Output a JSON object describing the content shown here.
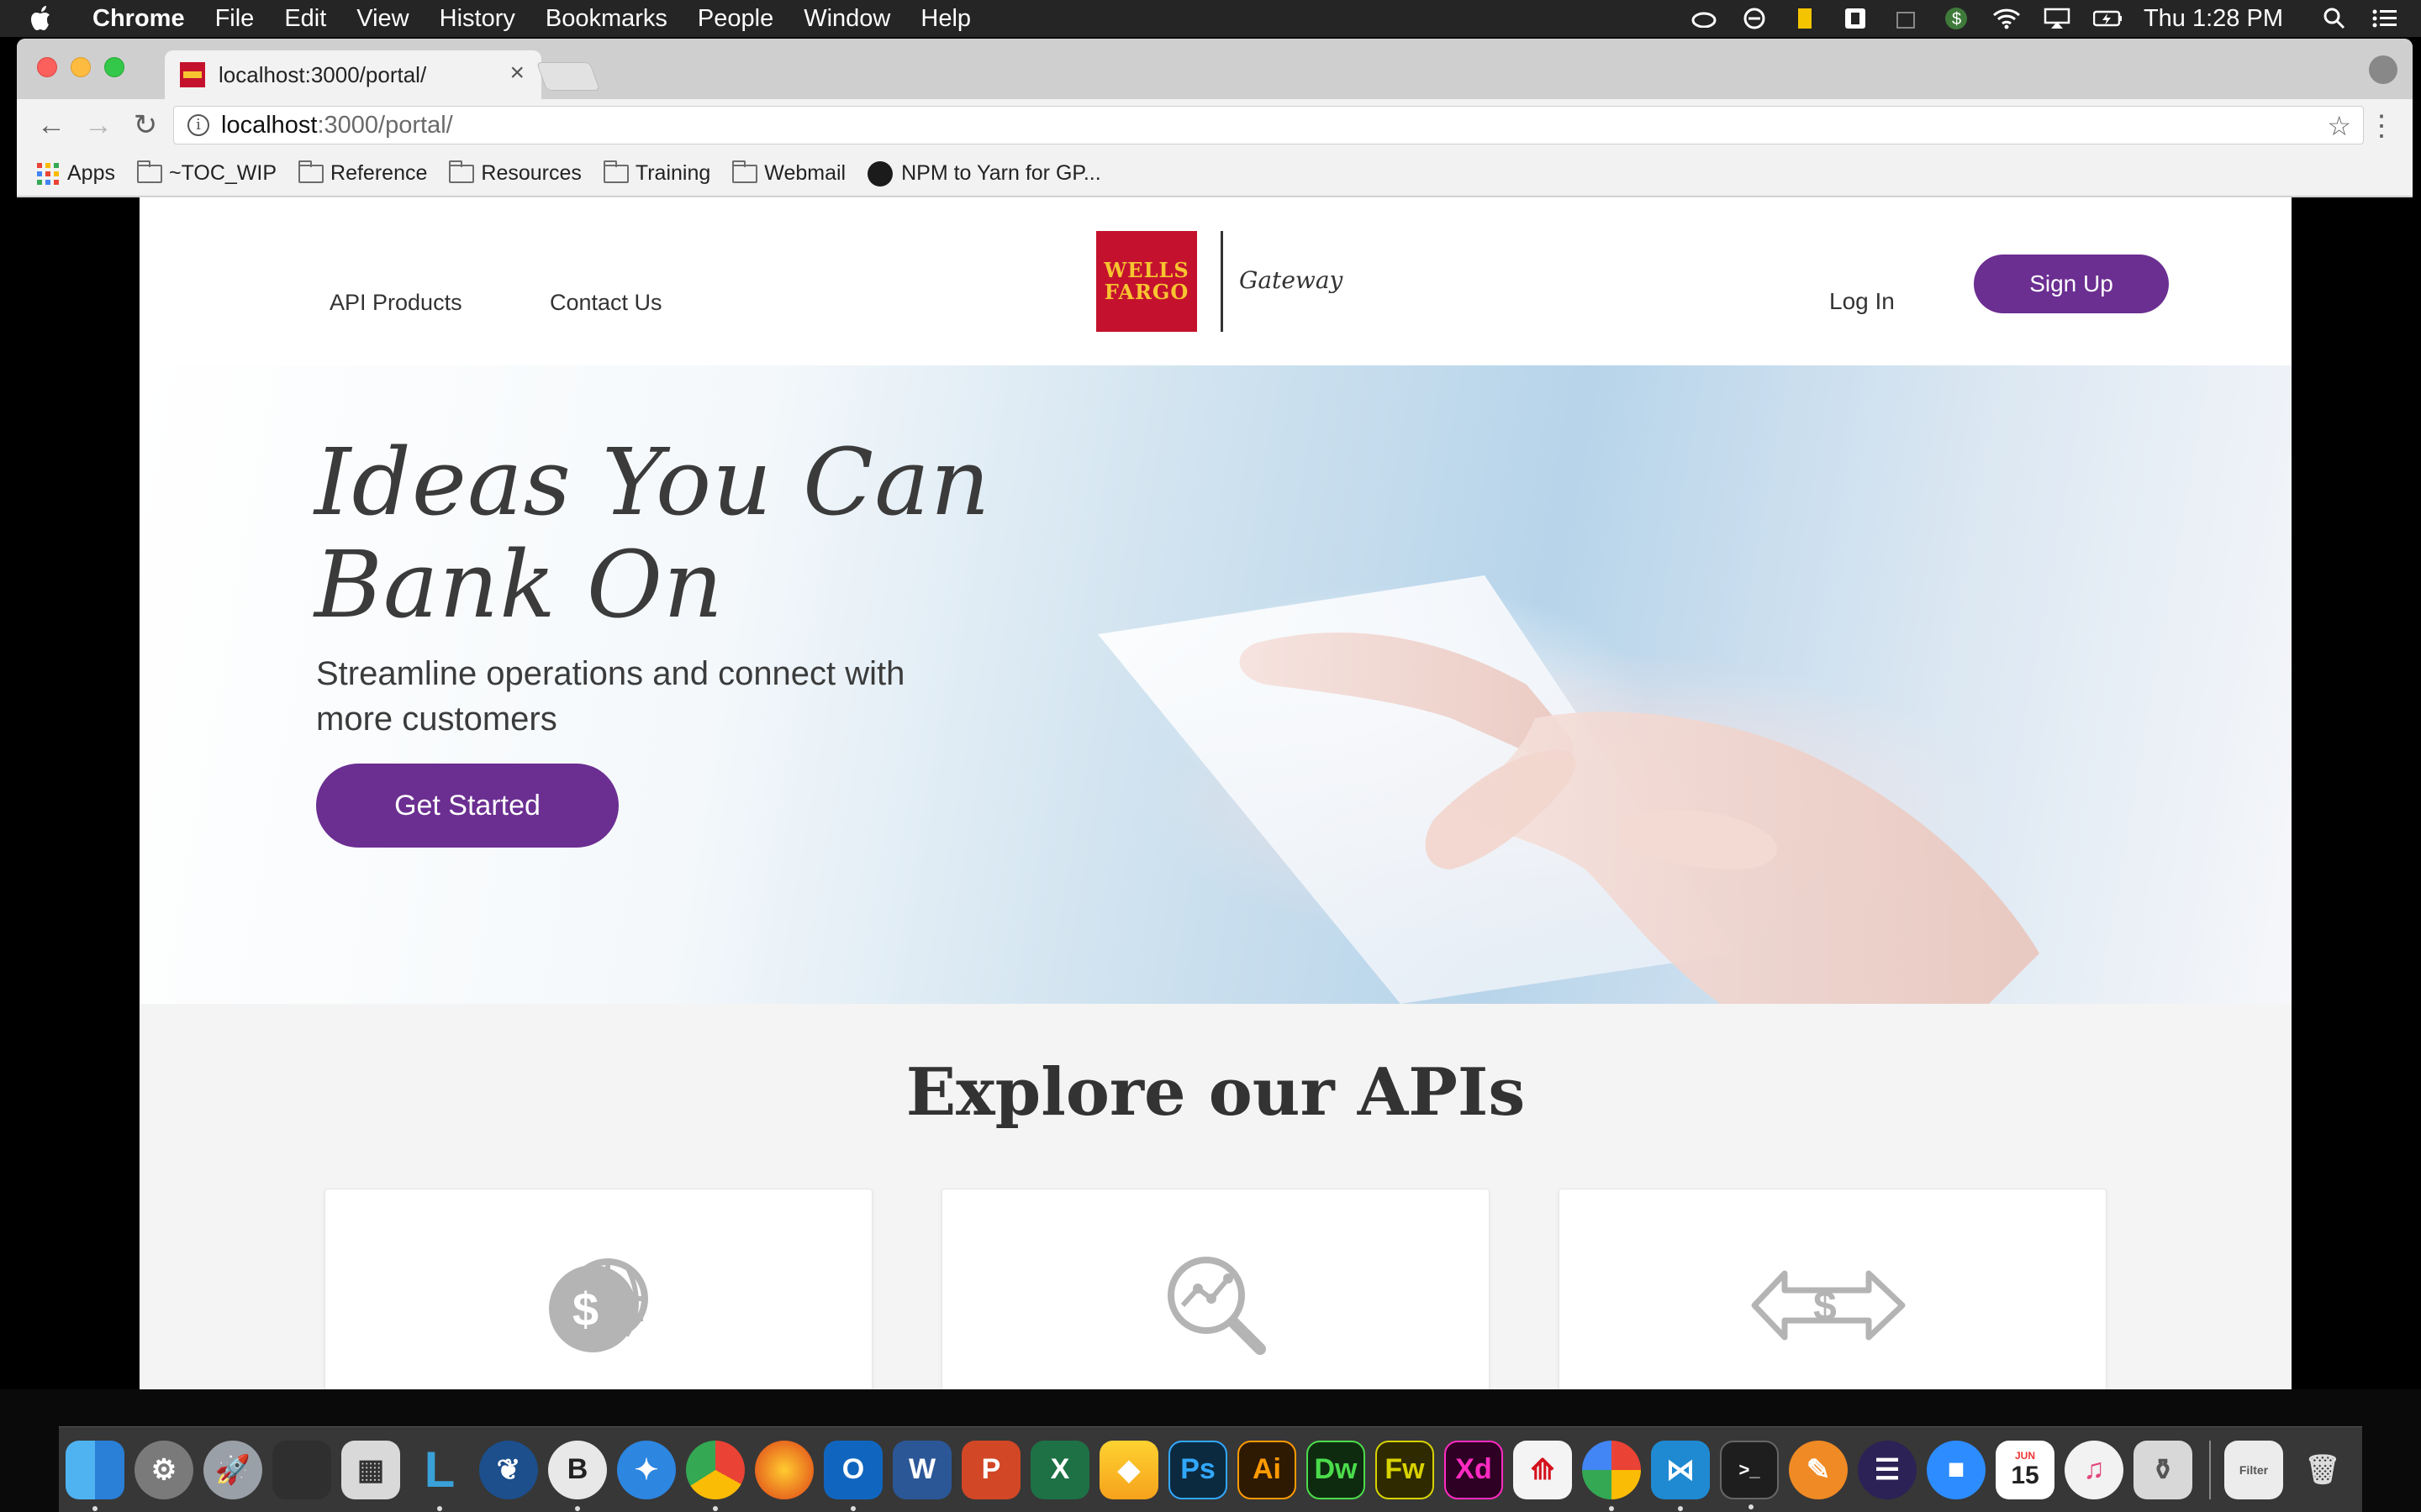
{
  "menubar": {
    "app_name": "Chrome",
    "items": [
      "File",
      "Edit",
      "View",
      "History",
      "Bookmarks",
      "People",
      "Window",
      "Help"
    ],
    "clock": "Thu 1:28 PM",
    "status_icons": [
      "creative-cloud-icon",
      "flow-icon",
      "clipboard-icon",
      "drive-icon",
      "dollar-icon",
      "wifi-icon",
      "airplay-icon",
      "battery-icon",
      "search-icon",
      "notification-list-icon"
    ]
  },
  "browser": {
    "tab_title": "localhost:3000/portal/",
    "url_host": "localhost",
    "url_path": ":3000/portal/",
    "bookmarks": [
      {
        "label": "Apps",
        "icon": "apps-grid-icon"
      },
      {
        "label": "~TOC_WIP",
        "icon": "folder-icon"
      },
      {
        "label": "Reference",
        "icon": "folder-icon"
      },
      {
        "label": "Resources",
        "icon": "folder-icon"
      },
      {
        "label": "Training",
        "icon": "folder-icon"
      },
      {
        "label": "Webmail",
        "icon": "folder-icon"
      },
      {
        "label": "NPM to Yarn for GP...",
        "icon": "github-icon"
      }
    ]
  },
  "site": {
    "nav": {
      "api_products": "API Products",
      "contact_us": "Contact Us",
      "login": "Log In",
      "signup": "Sign Up"
    },
    "logo": {
      "line1": "WELLS",
      "line2": "FARGO",
      "product": "Gateway"
    },
    "hero": {
      "title_line1": "Ideas You Can",
      "title_line2": "Bank On",
      "subtitle": "Streamline operations and connect with more customers",
      "cta": "Get Started"
    },
    "explore": {
      "title": "Explore our APIs",
      "cards": [
        {
          "icon": "globe-dollar-icon"
        },
        {
          "icon": "analytics-search-icon"
        },
        {
          "icon": "dollar-transfer-arrows-icon"
        }
      ]
    }
  },
  "colors": {
    "brand_red": "#c4122e",
    "brand_gold": "#f7c530",
    "purple": "#6b2e91"
  },
  "dock": {
    "apps": [
      "finder-icon",
      "system-preferences-icon",
      "launchpad-icon",
      "photo-booth-icon",
      "calculator-icon",
      "l-app-icon",
      "sourcetree-icon",
      "bbedit-icon",
      "safari-icon",
      "chrome-icon",
      "firefox-icon",
      "outlook-icon",
      "word-icon",
      "powerpoint-icon",
      "excel-icon",
      "sketch-icon",
      "photoshop-icon",
      "illustrator-icon",
      "dreamweaver-icon",
      "fireworks-icon",
      "xd-icon",
      "acrobat-icon",
      "pinwheel-icon",
      "vscode-icon",
      "terminal-icon",
      "pencil-icon",
      "eclipse-icon",
      "zoom-icon",
      "calendar-icon",
      "itunes-icon",
      "archive-icon",
      "filter-icon",
      "trash-icon"
    ],
    "labels": {
      "photoshop": "Ps",
      "illustrator": "Ai",
      "dreamweaver": "Dw",
      "fireworks": "Fw",
      "xd": "Xd",
      "calendar_day": "15",
      "calendar_month": "JUN"
    }
  }
}
